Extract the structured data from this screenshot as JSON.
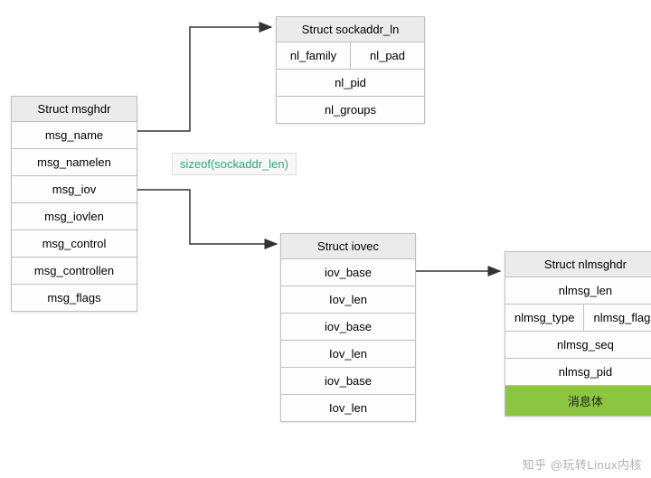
{
  "msghdr": {
    "title": "Struct msghdr",
    "fields": [
      "msg_name",
      "msg_namelen",
      "msg_iov",
      "msg_iovlen",
      "msg_control",
      "msg_controllen",
      "msg_flags"
    ]
  },
  "sockaddr": {
    "title": "Struct sockaddr_ln",
    "row1": {
      "left": "nl_family",
      "right": "nl_pad"
    },
    "row2": "nl_pid",
    "row3": "nl_groups"
  },
  "iovec": {
    "title": "Struct iovec",
    "fields": [
      "iov_base",
      "Iov_len",
      "iov_base",
      "Iov_len",
      "iov_base",
      "Iov_len"
    ]
  },
  "nlmsghdr": {
    "title": "Struct nlmsghdr",
    "row1": "nlmsg_len",
    "row2": {
      "left": "nlmsg_type",
      "right": "nlmsg_flags"
    },
    "row3": "nlmsg_seq",
    "row4": "nlmsg_pid",
    "row5": "消息体"
  },
  "annotation": "sizeof(sockaddr_len)",
  "watermark": "知乎 @玩转Linux内核"
}
